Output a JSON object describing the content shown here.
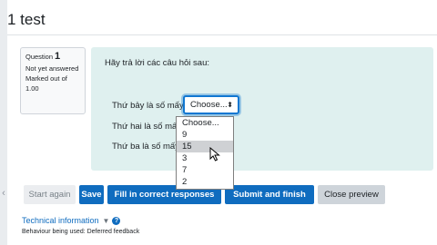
{
  "page": {
    "title": "1 test"
  },
  "question_info": {
    "label": "Question",
    "number": "1",
    "status": "Not yet answered",
    "marks": "Marked out of 1.00"
  },
  "question": {
    "prompt": "Hãy trả lời các câu hỏi sau:",
    "rows": [
      {
        "label": "Thứ bảy là số mấy"
      },
      {
        "label": "Thứ hai là số mấy"
      },
      {
        "label": "Thứ ba là số mấy"
      }
    ],
    "select": {
      "value": "Choose...",
      "caret": "⬍"
    },
    "dropdown_options": [
      "Choose...",
      "9",
      "15",
      "3",
      "7",
      "2"
    ],
    "hovered_option": "15"
  },
  "buttons": {
    "start_again": "Start again",
    "save": "Save",
    "fill_correct": "Fill in correct responses",
    "submit_finish": "Submit and finish",
    "close_preview": "Close preview"
  },
  "technical": {
    "label": "Technical information",
    "behaviour": "Behaviour being used: Deferred feedback"
  },
  "colors": {
    "primary": "#0f6cbf",
    "formulation_bg": "#dff0ef",
    "focus": "#1177d1"
  }
}
